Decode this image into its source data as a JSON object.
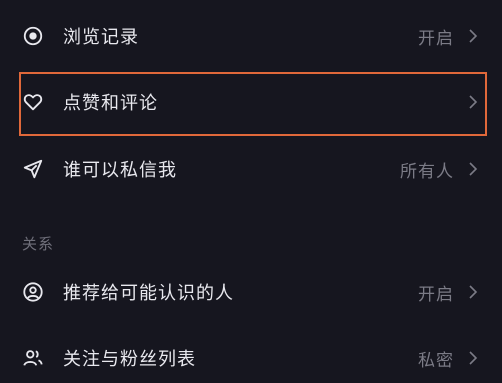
{
  "settings": {
    "items": [
      {
        "label": "浏览记录",
        "value": "开启",
        "icon": "eye-icon"
      },
      {
        "label": "点赞和评论",
        "value": "",
        "icon": "heart-icon"
      },
      {
        "label": "谁可以私信我",
        "value": "所有人",
        "icon": "send-icon"
      }
    ],
    "section_title": "关系",
    "relation_items": [
      {
        "label": "推荐给可能认识的人",
        "value": "开启",
        "icon": "person-circle-icon"
      },
      {
        "label": "关注与粉丝列表",
        "value": "私密",
        "icon": "people-icon"
      }
    ]
  },
  "colors": {
    "background": "#16161f",
    "text": "#e8e8ee",
    "secondary_text": "#7b7b86",
    "highlight": "#e0683a"
  }
}
